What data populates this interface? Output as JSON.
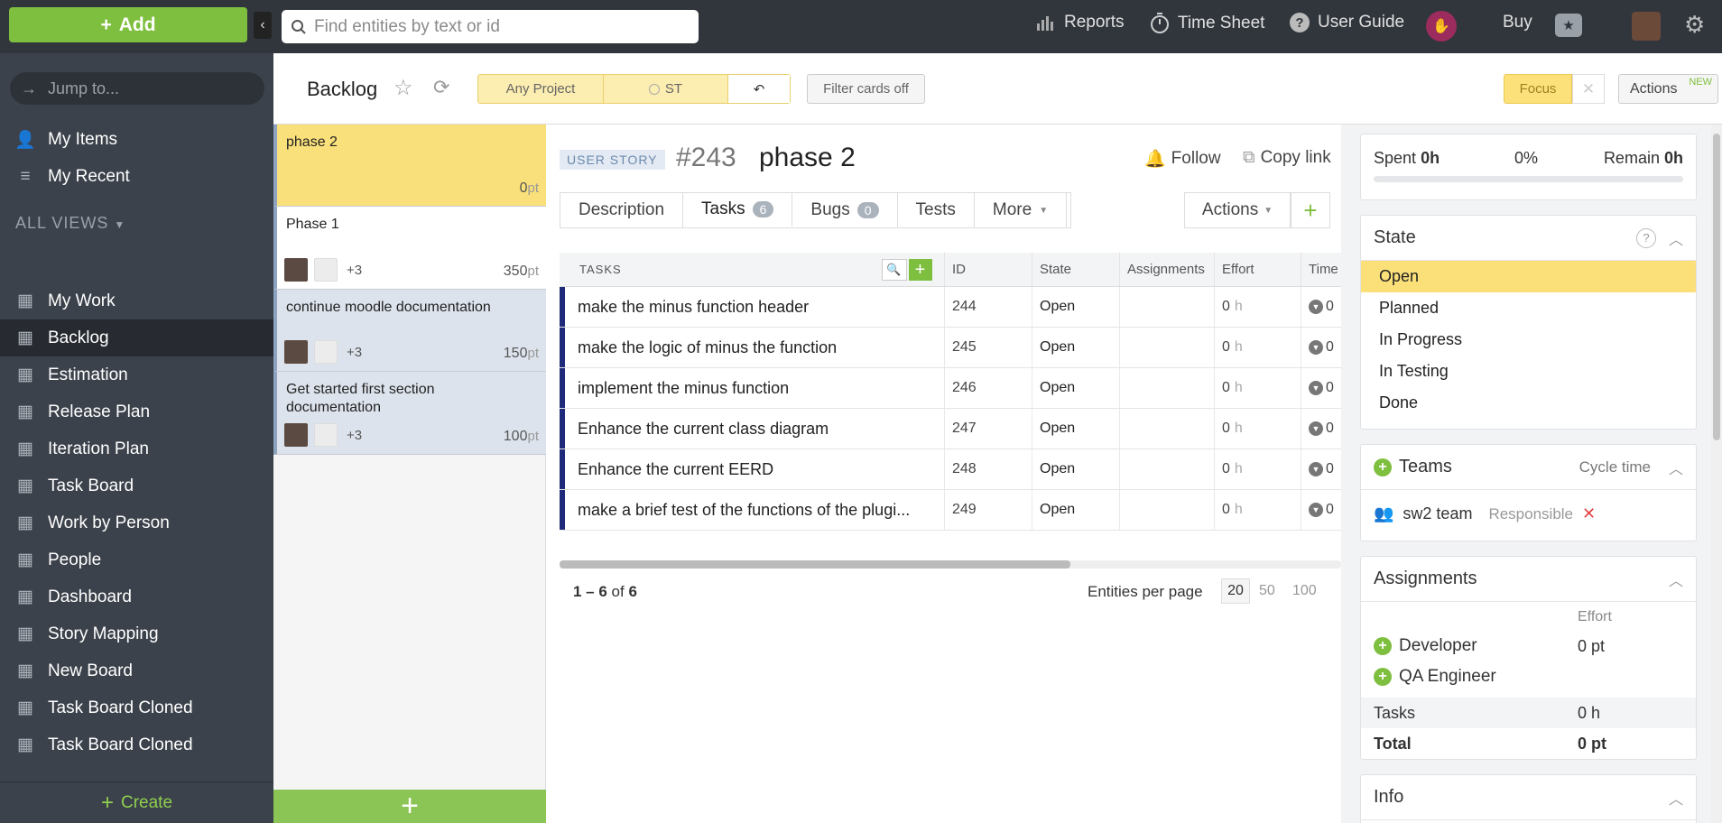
{
  "topbar": {
    "add_label": "Add",
    "search_placeholder": "Find entities by text or id",
    "reports": "Reports",
    "timesheet": "Time Sheet",
    "userguide": "User Guide",
    "buy": "Buy"
  },
  "sidebar": {
    "jump_placeholder": "Jump to...",
    "my_items": "My Items",
    "my_recent": "My Recent",
    "section": "ALL VIEWS",
    "items": [
      {
        "label": "My Work",
        "active": false
      },
      {
        "label": "Backlog",
        "active": true
      },
      {
        "label": "Estimation",
        "active": false
      },
      {
        "label": "Release Plan",
        "active": false
      },
      {
        "label": "Iteration Plan",
        "active": false
      },
      {
        "label": "Task Board",
        "active": false
      },
      {
        "label": "Work by Person",
        "active": false
      },
      {
        "label": "People",
        "active": false
      },
      {
        "label": "Dashboard",
        "active": false
      },
      {
        "label": "Story Mapping",
        "active": false
      },
      {
        "label": "New Board",
        "active": false
      },
      {
        "label": "Task Board Cloned",
        "active": false
      },
      {
        "label": "Task Board Cloned",
        "active": false
      }
    ],
    "create": "Create"
  },
  "header": {
    "title": "Backlog",
    "filter_project": "Any Project",
    "filter_team": "ST",
    "filter_cards": "Filter cards off",
    "focus": "Focus",
    "actions": "Actions",
    "actions_badge": "NEW"
  },
  "cards": [
    {
      "title": "phase 2",
      "points": "0",
      "unit": "pt",
      "extra": ""
    },
    {
      "title": "Phase 1",
      "points": "350",
      "unit": "pt",
      "extra": "+3"
    },
    {
      "title": "continue moodle documentation",
      "points": "150",
      "unit": "pt",
      "extra": "+3"
    },
    {
      "title": "Get started first section documentation",
      "points": "100",
      "unit": "pt",
      "extra": "+3"
    }
  ],
  "entity": {
    "type": "USER STORY",
    "id": "#243",
    "name": "phase 2",
    "follow": "Follow",
    "copy_link": "Copy link",
    "tabs": [
      {
        "label": "Description",
        "count": ""
      },
      {
        "label": "Tasks",
        "count": "6"
      },
      {
        "label": "Bugs",
        "count": "0"
      },
      {
        "label": "Tests",
        "count": ""
      },
      {
        "label": "More",
        "count": ""
      }
    ],
    "actions": "Actions"
  },
  "tasks_table": {
    "headers": {
      "tasks": "TASKS",
      "id": "ID",
      "state": "State",
      "assignments": "Assignments",
      "effort": "Effort",
      "time": "Time"
    },
    "rows": [
      {
        "name": "make the minus function header",
        "id": "244",
        "state": "Open",
        "effort": "0",
        "time": "0"
      },
      {
        "name": "make the logic of minus the function",
        "id": "245",
        "state": "Open",
        "effort": "0",
        "time": "0"
      },
      {
        "name": "implement the minus function",
        "id": "246",
        "state": "Open",
        "effort": "0",
        "time": "0"
      },
      {
        "name": "Enhance the current class diagram",
        "id": "247",
        "state": "Open",
        "effort": "0",
        "time": "0"
      },
      {
        "name": "Enhance the current EERD",
        "id": "248",
        "state": "Open",
        "effort": "0",
        "time": "0"
      },
      {
        "name": "make a brief test of the functions of the plugi...",
        "id": "249",
        "state": "Open",
        "effort": "0",
        "time": "0"
      }
    ],
    "effort_unit": "h",
    "pager_range": "1 – 6",
    "pager_of": "of",
    "pager_total": "6",
    "per_page_label": "Entities per page",
    "per_page_options": [
      "20",
      "50",
      "100"
    ]
  },
  "progress": {
    "spent_label": "Spent",
    "spent": "0h",
    "percent": "0%",
    "remain_label": "Remain",
    "remain": "0h"
  },
  "state_box": {
    "title": "State",
    "items": [
      "Open",
      "Planned",
      "In Progress",
      "In Testing",
      "Done"
    ],
    "selected": "Open"
  },
  "teams_box": {
    "title": "Teams",
    "cycle_time": "Cycle time",
    "team": "sw2 team",
    "role": "Responsible"
  },
  "assignments_box": {
    "title": "Assignments",
    "effort_header": "Effort",
    "roles": [
      {
        "label": "Developer",
        "effort": "0 pt"
      },
      {
        "label": "QA Engineer",
        "effort": ""
      }
    ],
    "tasks_label": "Tasks",
    "tasks_value": "0 h",
    "total_label": "Total",
    "total_value": "0 pt"
  },
  "info_box": {
    "title": "Info"
  },
  "colors": {
    "accent_green": "#7fbf3f",
    "selected_yellow": "#fbe07a",
    "sidebar": "#3c424b",
    "topbar": "#31363d"
  }
}
